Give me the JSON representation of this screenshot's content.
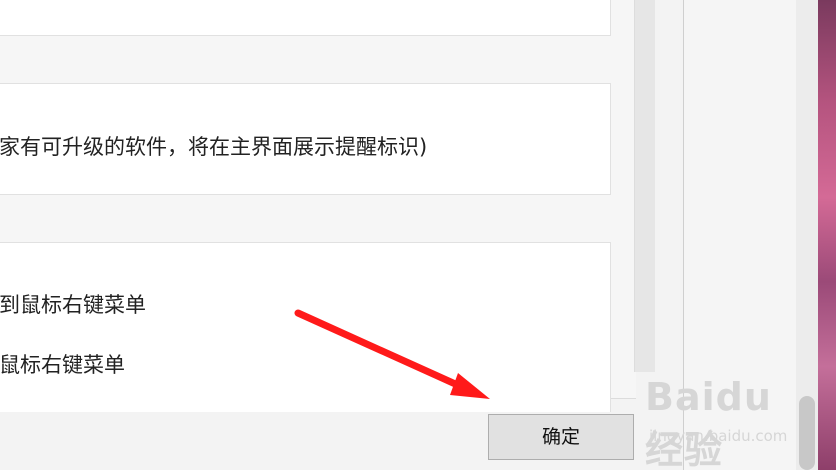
{
  "settings": {
    "upgrade_notice_text": "家有可升级的软件，将在主界面展示提醒标识)",
    "context_menu_option_1": "到鼠标右键菜单",
    "context_menu_option_2": "鼠标右键菜单"
  },
  "footer": {
    "ok_label": "确定"
  },
  "annotation": {
    "arrow_color": "#ff1a1a"
  },
  "watermark": {
    "logo": "Baidu经验",
    "sub": "jingyan.baidu.com"
  }
}
